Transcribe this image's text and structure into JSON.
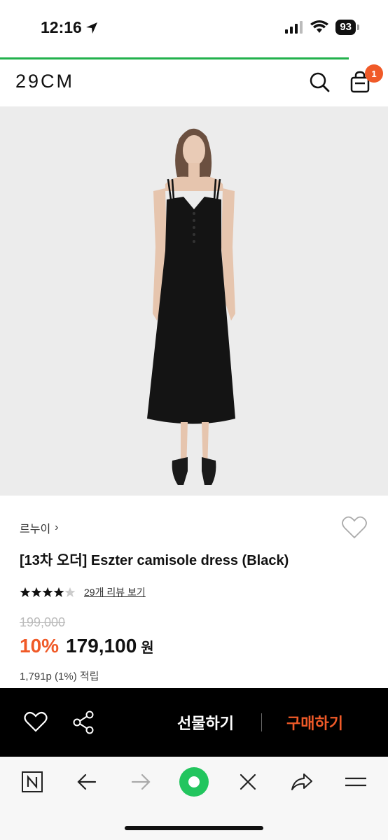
{
  "status_bar": {
    "time": "12:16",
    "battery": "93"
  },
  "header": {
    "logo": "29CM",
    "cart_count": "1"
  },
  "product": {
    "brand": "르누이",
    "brand_chevron": "›",
    "title": "[13차 오더] Eszter camisole dress (Black)",
    "rating": 4.5,
    "review_link": "29개 리뷰 보기",
    "original_price": "199,000",
    "discount": "10%",
    "price": "179,100",
    "currency": "원",
    "points": "1,791p (1%) 적립"
  },
  "purchase_bar": {
    "gift_label": "선물하기",
    "buy_label": "구매하기"
  },
  "colors": {
    "accent": "#f05a28",
    "load_bar": "#22b14c",
    "browser_green": "#22c55e"
  }
}
